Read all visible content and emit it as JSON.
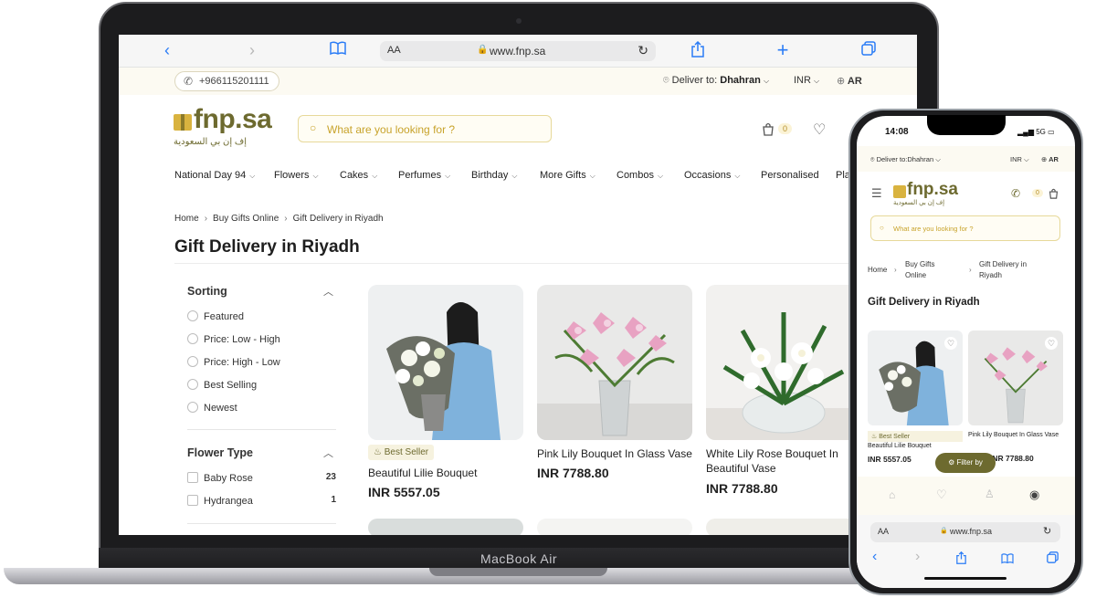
{
  "laptop": {
    "brand_label": "MacBook Air",
    "browser": {
      "text_size_label": "AA",
      "url": "www.fnp.sa"
    },
    "site": {
      "phone": "+966115201111",
      "deliver_label": "Deliver to:",
      "deliver_city": "Dhahran",
      "currency": "INR",
      "language": "AR",
      "logo_text": "fnp.sa",
      "logo_arabic": "إف إن بي السعودية",
      "search_placeholder": "What are you looking for ?",
      "cart_count": "0",
      "nav": [
        "National Day 94",
        "Flowers",
        "Cakes",
        "Perfumes",
        "Birthday",
        "More Gifts",
        "Combos",
        "Occasions",
        "Personalised",
        "Pla"
      ],
      "breadcrumb": [
        "Home",
        "Buy Gifts Online",
        "Gift Delivery in Riyadh"
      ],
      "page_title": "Gift Delivery in Riyadh",
      "sorting": {
        "title": "Sorting",
        "options": [
          "Featured",
          "Price: Low - High",
          "Price: High - Low",
          "Best Selling",
          "Newest"
        ]
      },
      "flower_type": {
        "title": "Flower Type",
        "options": [
          {
            "label": "Baby Rose",
            "count": "23"
          },
          {
            "label": "Hydrangea",
            "count": "1"
          }
        ]
      },
      "products": [
        {
          "badge": "Best Seller",
          "name": "Beautiful Lilie Bouquet",
          "price": "INR 5557.05"
        },
        {
          "name": "Pink Lily Bouquet In Glass Vase",
          "price": "INR 7788.80"
        },
        {
          "name": "White Lily Rose Bouquet In Beautiful Vase",
          "price": "INR 7788.80"
        }
      ]
    }
  },
  "phone": {
    "time": "14:08",
    "status": "5G",
    "deliver_label": "Deliver to:",
    "deliver_city": "Dhahran",
    "currency": "INR",
    "language": "AR",
    "logo_text": "fnp.sa",
    "logo_arabic": "إف إن بي السعودية",
    "cart_count": "0",
    "search_placeholder": "What are you looking for ?",
    "breadcrumb": [
      "Home",
      "Buy Gifts Online",
      "Gift Delivery in Riyadh"
    ],
    "page_title": "Gift Delivery in Riyadh",
    "products": [
      {
        "badge": "Best Seller",
        "name": "Beautiful Lilie Bouquet",
        "price": "INR 5557.05"
      },
      {
        "name": "Pink Lily Bouquet In Glass Vase",
        "price": "INR 7788.80"
      }
    ],
    "filter_label": "Filter by",
    "text_size_label": "AA",
    "url": "www.fnp.sa"
  }
}
